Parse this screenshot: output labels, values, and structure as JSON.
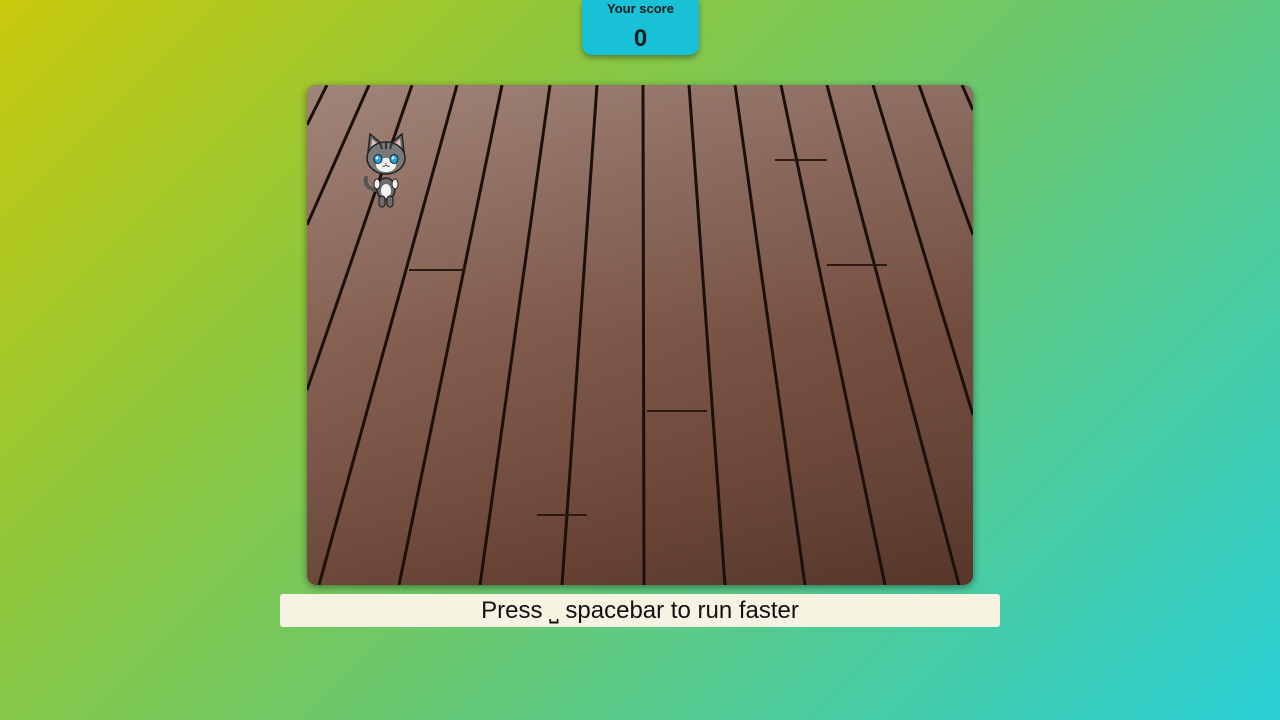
{
  "score": {
    "label": "Your score",
    "value": "0"
  },
  "game": {
    "background": "wooden-deck-floor",
    "player": "cat-sprite"
  },
  "hint": {
    "text": "Press ⎵ spacebar to run faster"
  },
  "colors": {
    "score_box": "#18c1d6",
    "hint_bar": "#f6f3e3",
    "floor": "#6e4a3c"
  }
}
